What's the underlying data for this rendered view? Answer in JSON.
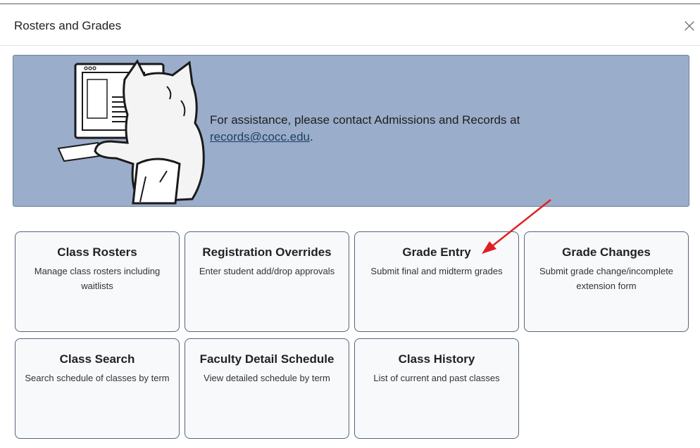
{
  "modal": {
    "title": "Rosters and Grades",
    "close_glyph": "×"
  },
  "banner": {
    "text_before": "For assistance, please contact Admissions and Records at",
    "email": "records@cocc.edu",
    "text_after": "."
  },
  "cards": [
    {
      "title": "Class Rosters",
      "description": "Manage class rosters including waitlists"
    },
    {
      "title": "Registration Overrides",
      "description": "Enter student add/drop approvals"
    },
    {
      "title": "Grade Entry",
      "description": "Submit final and midterm grades"
    },
    {
      "title": "Grade Changes",
      "description": "Submit grade change/incomplete extension form"
    },
    {
      "title": "Class Search",
      "description": "Search schedule of classes by term"
    },
    {
      "title": "Faculty Detail Schedule",
      "description": "View detailed schedule by term"
    },
    {
      "title": "Class History",
      "description": "List of current and past classes"
    }
  ],
  "colors": {
    "banner_background": "#9aadca",
    "card_border": "#56657a",
    "annotation_arrow": "#e02020"
  }
}
